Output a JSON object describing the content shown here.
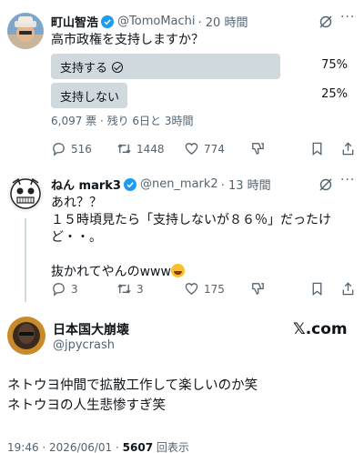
{
  "tweet1": {
    "name": "町山智浩",
    "handle": "@TomoMachi",
    "time": "· 20 時間",
    "text": "高市政権を支持しますか？",
    "poll": {
      "options": [
        {
          "label": "支持する",
          "percent_text": "75%",
          "percent": 75,
          "selected": true
        },
        {
          "label": "支持しない",
          "percent_text": "25%",
          "percent": 25,
          "selected": false
        }
      ],
      "meta": "6,097 票 · 残り 6日と 3時間"
    },
    "actions": {
      "replies": "516",
      "reposts": "1448",
      "likes": "774"
    }
  },
  "tweet2": {
    "name": "ねん mark3",
    "handle": "@nen_mark2",
    "time": "· 13 時間",
    "lines": [
      "あれ？？",
      "１５時頃見たら「支持しないが８６％」だったけ",
      "ど・・。",
      "",
      "抜かれてやんのwww"
    ],
    "actions": {
      "replies": "3",
      "reposts": "3",
      "likes": "175"
    }
  },
  "quote": {
    "name": "日本国大崩壊",
    "handle": "@jpycrash",
    "logo": "𝕏.com",
    "lines": [
      "ネトウヨ仲間で拡散工作して楽しいのか笑",
      "ネトウヨの人生悲惨すぎ笑"
    ],
    "footer_time": "19:46 · 2026/06/01 · ",
    "footer_views": "5607",
    "footer_views_label": " 回表示"
  },
  "colors": {
    "verified": "#1d9bf0",
    "muted": "#536471",
    "poll_bar": "#cfd9de"
  }
}
